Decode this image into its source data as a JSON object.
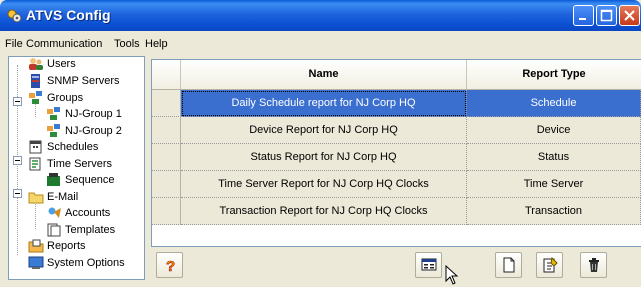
{
  "window": {
    "title": "ATVS Config",
    "title_bar_color": "#0a4fd1",
    "minimize_icon": "minimize-icon",
    "maximize_icon": "maximize-icon",
    "close_icon": "close-icon"
  },
  "menu": {
    "file": "File",
    "communication": "Communication",
    "tools": "Tools",
    "help": "Help"
  },
  "tree": {
    "users": "Users",
    "snmp_servers": "SNMP Servers",
    "groups": "Groups",
    "nj_group_1": "NJ-Group 1",
    "nj_group_2": "NJ-Group 2",
    "schedules": "Schedules",
    "time_servers": "Time Servers",
    "sequence": "Sequence",
    "email": "E-Mail",
    "accounts": "Accounts",
    "templates": "Templates",
    "reports": "Reports",
    "system_options": "System Options",
    "selected": "Reports"
  },
  "grid": {
    "columns": {
      "name": "Name",
      "report_type": "Report Type"
    },
    "rows": [
      {
        "name": "Daily Schedule report for NJ Corp HQ",
        "type": "Schedule"
      },
      {
        "name": "Device Report for NJ Corp HQ",
        "type": "Device"
      },
      {
        "name": "Status Report for NJ Corp HQ",
        "type": "Status"
      },
      {
        "name": "Time Server Report for NJ Corp HQ Clocks",
        "type": "Time Server"
      },
      {
        "name": "Transaction Report for NJ Corp HQ Clocks",
        "type": "Transaction"
      }
    ],
    "selected_row": 0,
    "selection_color": "#3a6fd0"
  },
  "toolbar": {
    "help": "question-mark-icon",
    "view": "report-view-icon",
    "new": "new-document-icon",
    "edit": "edit-document-icon",
    "delete": "trash-icon"
  }
}
